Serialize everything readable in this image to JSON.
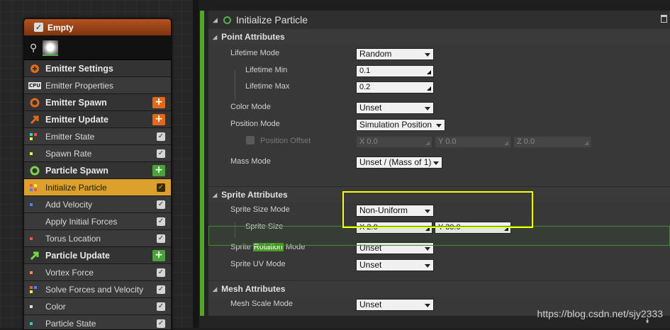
{
  "node": {
    "title": "Empty",
    "rows": [
      {
        "label": "Emitter Settings",
        "kind": "stage",
        "icon": "emitter-settings-icon",
        "color": "#e0691b"
      },
      {
        "label": "Emitter Properties",
        "kind": "mod",
        "icon": "cpu-icon"
      },
      {
        "label": "Emitter Spawn",
        "kind": "stage",
        "icon": "emitter-spawn-icon",
        "color": "#e0691b",
        "button": "+"
      },
      {
        "label": "Emitter Update",
        "kind": "stage",
        "icon": "emitter-update-icon",
        "color": "#e0691b",
        "button": "+"
      },
      {
        "label": "Emitter State",
        "kind": "mod",
        "checked": true
      },
      {
        "label": "Spawn Rate",
        "kind": "mod",
        "checked": true
      },
      {
        "label": "Particle Spawn",
        "kind": "stage",
        "icon": "particle-spawn-icon",
        "color": "#4aa33a",
        "button": "+"
      },
      {
        "label": "Initialize Particle",
        "kind": "mod",
        "selected": true,
        "checked": true
      },
      {
        "label": "Add Velocity",
        "kind": "mod",
        "checked": true
      },
      {
        "label": "Apply Initial Forces",
        "kind": "mod",
        "checked": true
      },
      {
        "label": "Torus Location",
        "kind": "mod",
        "checked": true
      },
      {
        "label": "Particle Update",
        "kind": "stage",
        "icon": "particle-update-icon",
        "color": "#4aa33a",
        "button": "+"
      },
      {
        "label": "Vortex Force",
        "kind": "mod",
        "checked": true
      },
      {
        "label": "Solve Forces and Velocity",
        "kind": "mod",
        "checked": true
      },
      {
        "label": "Color",
        "kind": "mod",
        "checked": true
      },
      {
        "label": "Particle State",
        "kind": "mod",
        "checked": true
      }
    ]
  },
  "details": {
    "title": "Initialize Particle",
    "point_attributes": {
      "header": "Point Attributes",
      "lifetime_mode_label": "Lifetime Mode",
      "lifetime_mode_value": "Random",
      "lifetime_min_label": "Lifetime Min",
      "lifetime_min_value": "0.1",
      "lifetime_max_label": "Lifetime Max",
      "lifetime_max_value": "0.2",
      "color_mode_label": "Color Mode",
      "color_mode_value": "Unset",
      "position_mode_label": "Position Mode",
      "position_mode_value": "Simulation Position",
      "position_offset_label": "Position Offset",
      "position_offset": {
        "x": "X  0.0",
        "y": "Y  0.0",
        "z": "Z  0.0"
      },
      "mass_mode_label": "Mass Mode",
      "mass_mode_value": "Unset / (Mass of 1)"
    },
    "sprite_attributes": {
      "header": "Sprite Attributes",
      "sprite_size_mode_label": "Sprite Size Mode",
      "sprite_size_mode_value": "Non-Uniform",
      "sprite_size_label": "Sprite Size",
      "sprite_size_x": "X  2.0",
      "sprite_size_y": "Y  30.0",
      "sprite_rotation_mode_label_pre": "Sprite ",
      "sprite_rotation_mode_label_hl": "Rotation",
      "sprite_rotation_mode_label_post": " Mode",
      "sprite_rotation_mode_value": "Unset",
      "sprite_uv_mode_label": "Sprite UV Mode",
      "sprite_uv_mode_value": "Unset"
    },
    "mesh_attributes": {
      "header": "Mesh Attributes",
      "mesh_scale_mode_label": "Mesh Scale Mode",
      "mesh_scale_mode_value": "Unset"
    }
  },
  "watermark": "https://blog.csdn.net/sjy2333"
}
